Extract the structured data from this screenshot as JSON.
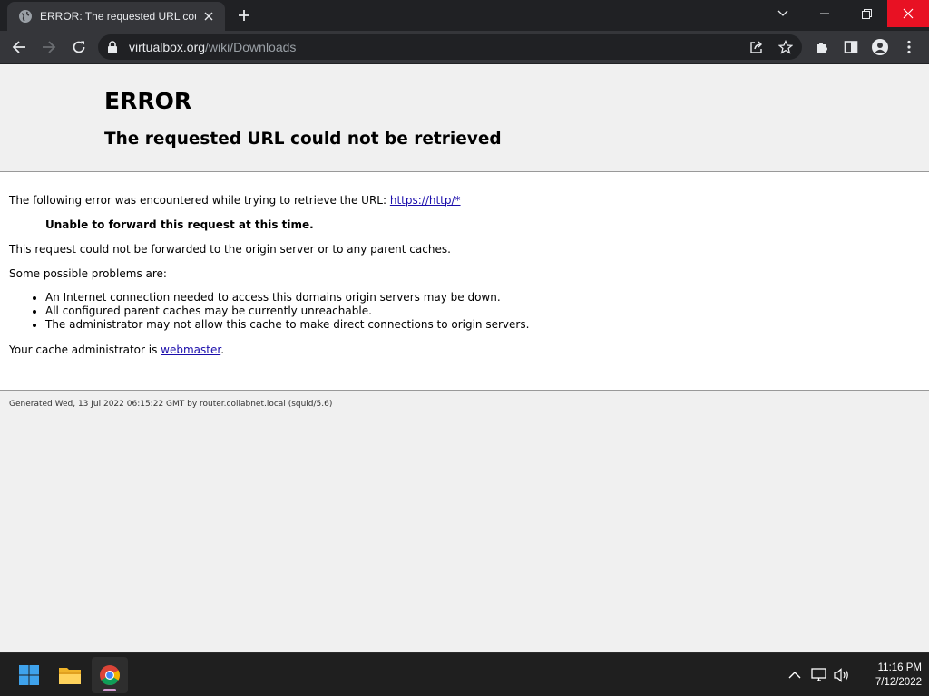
{
  "browser": {
    "tab_title": "ERROR: The requested URL could not be retrieved",
    "url_host": "virtualbox.org",
    "url_path": "/wiki/Downloads"
  },
  "page": {
    "title": "ERROR",
    "subtitle": "The requested URL could not be retrieved",
    "intro": "The following error was encountered while trying to retrieve the URL: ",
    "intro_link": "https://http/*",
    "error_detail": "Unable to forward this request at this time.",
    "explanation": "This request could not be forwarded to the origin server or to any parent caches.",
    "problems_heading": "Some possible problems are:",
    "problems": [
      "An Internet connection needed to access this domains origin servers may be down.",
      "All configured parent caches may be currently unreachable.",
      "The administrator may not allow this cache to make direct connections to origin servers."
    ],
    "admin_text": "Your cache administrator is ",
    "admin_link": "webmaster",
    "admin_end": ".",
    "footer": "Generated Wed, 13 Jul 2022 06:15:22 GMT by router.collabnet.local (squid/5.6)"
  },
  "taskbar": {
    "time": "11:16 PM",
    "date": "7/12/2022",
    "apps": [
      "start-icon",
      "file-explorer-icon",
      "chrome-icon"
    ]
  },
  "colors": {
    "close_button": "#e81123",
    "link": "#1a0dab",
    "page_bg": "#f0f0f0"
  }
}
